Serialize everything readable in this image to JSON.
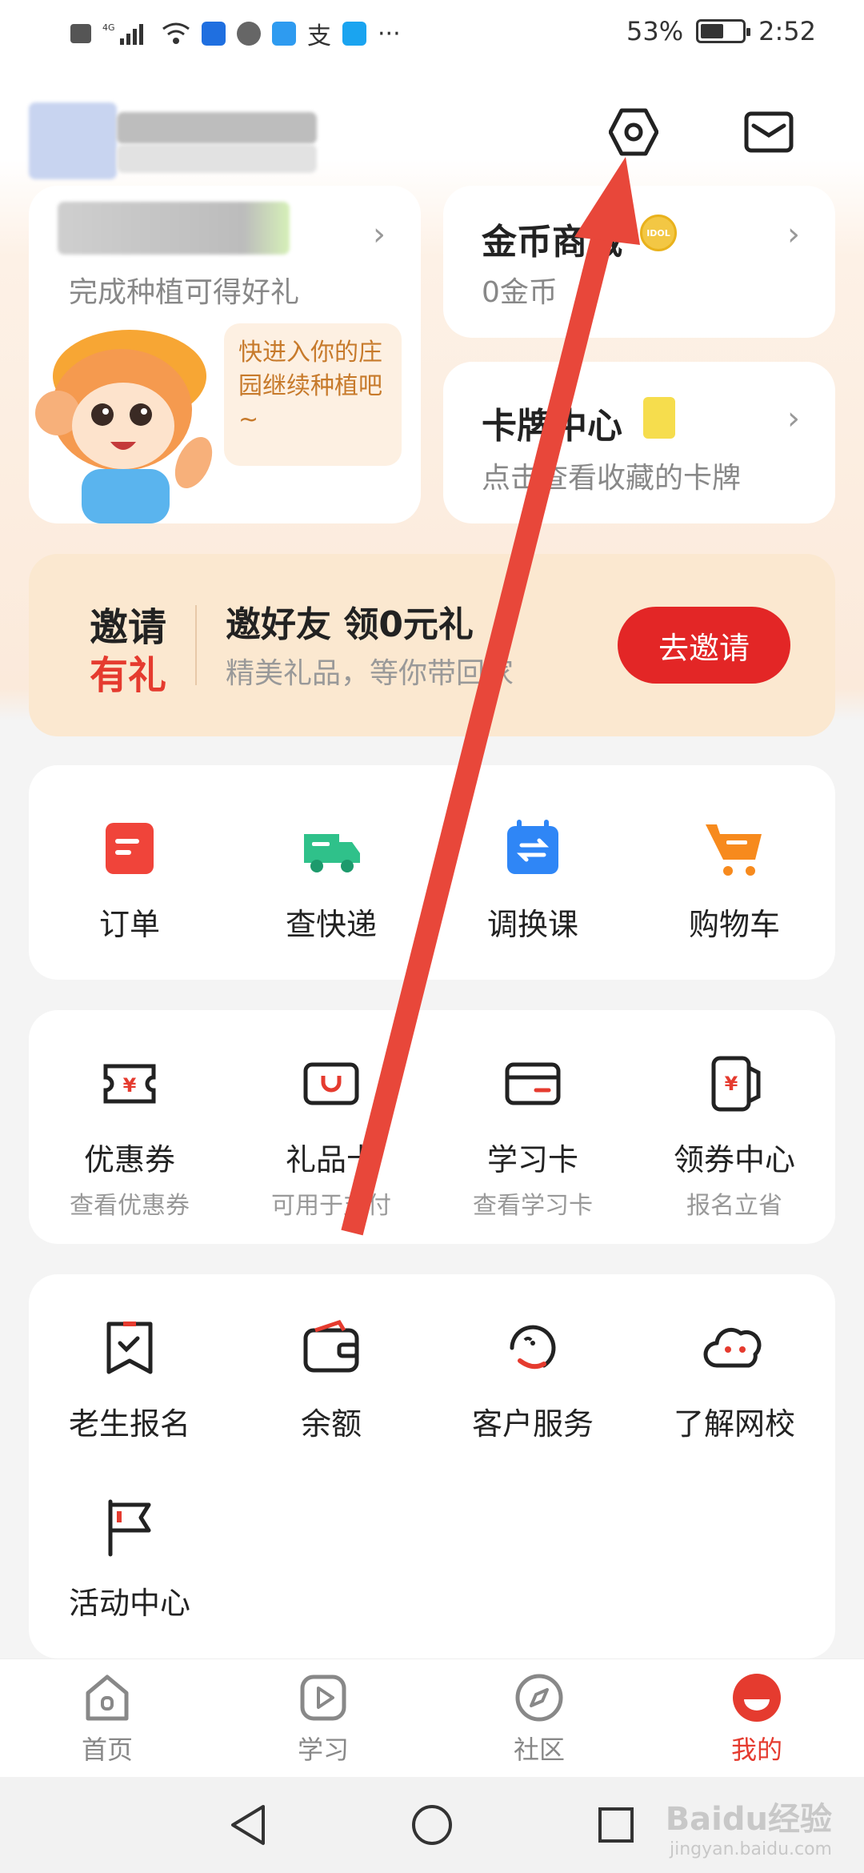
{
  "status_bar": {
    "network_icons": [
      "hd-icon",
      "4g-icon",
      "signal-icon",
      "wifi-icon"
    ],
    "battery": "53%",
    "time": "2:52"
  },
  "header": {
    "settings_icon": "settings-hex-icon",
    "message_icon": "mail-icon"
  },
  "farm_card": {
    "subtitle": "完成种植可得好礼",
    "bubble_text": "快进入你的庄园继续种植吧~"
  },
  "coin_card": {
    "title": "金币商城",
    "badge": "IDOL",
    "subtitle": "0金币"
  },
  "card_center": {
    "title": "卡牌中心",
    "subtitle": "点击查看收藏的卡牌"
  },
  "invite_banner": {
    "label_line1": "邀请",
    "label_line2": "有礼",
    "title": "邀好友 领0元礼",
    "subtitle": "精美礼品，等你带回家",
    "button": "去邀请"
  },
  "section1": [
    {
      "label": "订单",
      "icon": "order-icon"
    },
    {
      "label": "查快递",
      "icon": "delivery-truck-icon"
    },
    {
      "label": "调换课",
      "icon": "swap-course-icon"
    },
    {
      "label": "购物车",
      "icon": "cart-icon"
    }
  ],
  "section2": [
    {
      "label": "优惠券",
      "sub": "查看优惠券",
      "icon": "coupon-icon"
    },
    {
      "label": "礼品卡",
      "sub": "可用于支付",
      "icon": "gift-card-icon"
    },
    {
      "label": "学习卡",
      "sub": "查看学习卡",
      "icon": "study-card-icon"
    },
    {
      "label": "领券中心",
      "sub": "报名立省",
      "icon": "coupon-center-icon"
    }
  ],
  "section3": [
    {
      "label": "老生报名",
      "icon": "bookmark-check-icon"
    },
    {
      "label": "余额",
      "icon": "wallet-icon"
    },
    {
      "label": "客户服务",
      "icon": "customer-service-icon"
    },
    {
      "label": "了解网校",
      "icon": "cloud-face-icon"
    },
    {
      "label": "活动中心",
      "icon": "flag-icon"
    }
  ],
  "tabbar": [
    {
      "label": "首页",
      "icon": "home-icon",
      "active": false
    },
    {
      "label": "学习",
      "icon": "play-icon",
      "active": false
    },
    {
      "label": "社区",
      "icon": "compass-icon",
      "active": false
    },
    {
      "label": "我的",
      "icon": "profile-icon",
      "active": true
    }
  ],
  "system_nav": [
    "back-icon",
    "home-circle-icon",
    "recent-apps-icon"
  ],
  "watermark": {
    "brand": "Baidu经验",
    "url": "jingyan.baidu.com"
  },
  "colors": {
    "accent": "#e53b2f",
    "invite_bg": "#fbe8d0",
    "arrow": "#e8473a"
  }
}
